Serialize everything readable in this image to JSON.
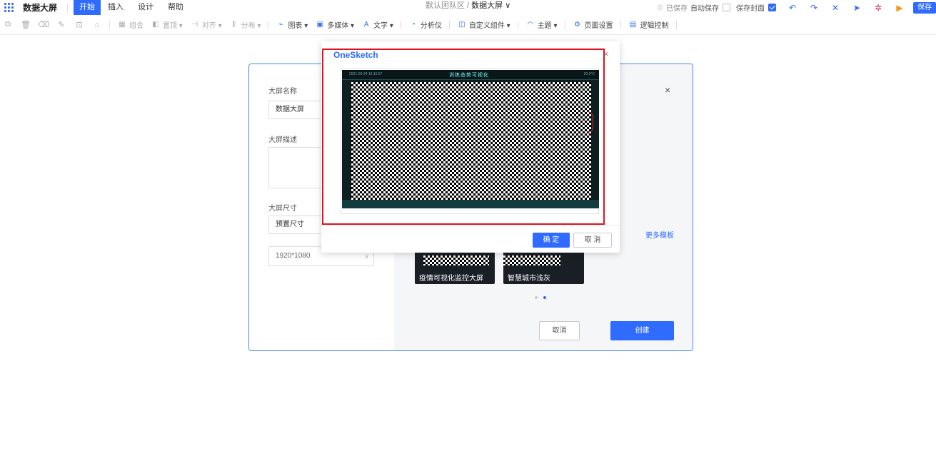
{
  "menubar": {
    "app_title": "数据大屏",
    "tabs": [
      "开始",
      "插入",
      "设计",
      "帮助"
    ],
    "breadcrumb_team": "默认团队区 / ",
    "breadcrumb_doc": "数据大屏 ∨",
    "saved_status": "已保存",
    "autosave_label": "自动保存",
    "save_cover_label": "保存封面",
    "save_button": "保存"
  },
  "toolbar": {
    "items": [
      {
        "label": "组合",
        "icon": "group-icon"
      },
      {
        "label": "置顶 ▾",
        "icon": "layer-top-icon"
      },
      {
        "label": "对齐 ▾",
        "icon": "align-icon"
      },
      {
        "label": "分布 ▾",
        "icon": "distribute-icon"
      },
      {
        "label": "图表 ▾",
        "icon": "chart-icon"
      },
      {
        "label": "多媒体 ▾",
        "icon": "media-icon"
      },
      {
        "label": "文字 ▾",
        "icon": "text-icon"
      },
      {
        "label": "分析仪",
        "icon": "analyzer-icon"
      },
      {
        "label": "自定义组件 ▾",
        "icon": "custom-component-icon"
      },
      {
        "label": "主题 ▾",
        "icon": "theme-icon"
      },
      {
        "label": "页面设置",
        "icon": "page-settings-icon"
      },
      {
        "label": "逻辑控制",
        "icon": "logic-control-icon"
      }
    ]
  },
  "create_dialog": {
    "name_label": "大屏名称",
    "name_value": "数据大屏",
    "desc_label": "大屏描述",
    "size_label": "大屏尺寸",
    "size_mode": "预置尺寸",
    "size_value": "1920*1080",
    "more_templates": "更多模板",
    "templates": [
      "疫情可视化监控大屏",
      "智慧城市浅灰"
    ],
    "cancel": "取消",
    "create": "创建",
    "close": "×"
  },
  "onesketch_dialog": {
    "title": "OneSketch",
    "close": "×",
    "preview_title": "训练态势可视化",
    "preview_time": "2021-05-24 16:15:57",
    "preview_weather": "30.0°C",
    "ok": "确 定",
    "cancel": "取 消"
  },
  "colors": {
    "accent": "#2f6bff",
    "highlight_border": "#e0121f"
  }
}
